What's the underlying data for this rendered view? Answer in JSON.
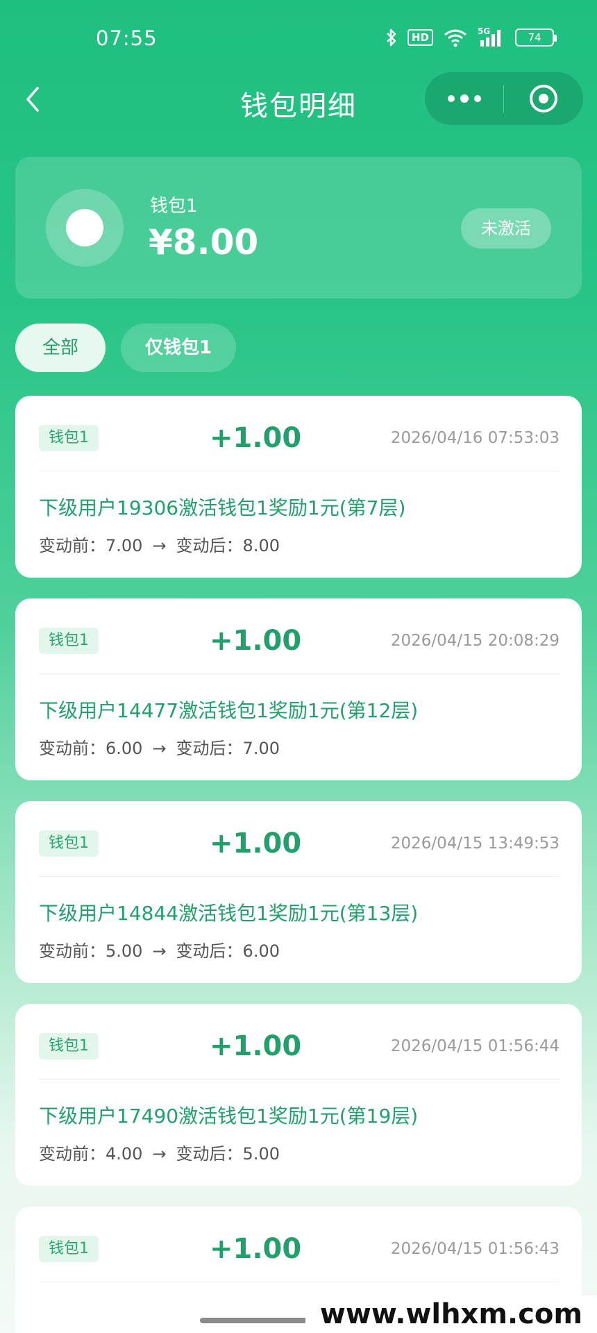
{
  "status_bar": {
    "time": "07:55",
    "network": "5G",
    "battery": "74",
    "hd": "HD"
  },
  "nav": {
    "title": "钱包明细"
  },
  "wallet": {
    "name": "钱包1",
    "balance": "¥8.00",
    "status": "未激活"
  },
  "tabs": [
    {
      "label": "全部",
      "selected": true
    },
    {
      "label": "仅钱包1",
      "selected": false
    }
  ],
  "transactions": [
    {
      "wallet": "钱包1",
      "amount": "+1.00",
      "time": "2026/04/16 07:53:03",
      "desc": "下级用户19306激活钱包1奖励1元(第7层)",
      "before_label": "变动前：",
      "before": "7.00",
      "arrow": "→",
      "after_label": "变动后：",
      "after": "8.00"
    },
    {
      "wallet": "钱包1",
      "amount": "+1.00",
      "time": "2026/04/15 20:08:29",
      "desc": "下级用户14477激活钱包1奖励1元(第12层)",
      "before_label": "变动前：",
      "before": "6.00",
      "arrow": "→",
      "after_label": "变动后：",
      "after": "7.00"
    },
    {
      "wallet": "钱包1",
      "amount": "+1.00",
      "time": "2026/04/15 13:49:53",
      "desc": "下级用户14844激活钱包1奖励1元(第13层)",
      "before_label": "变动前：",
      "before": "5.00",
      "arrow": "→",
      "after_label": "变动后：",
      "after": "6.00"
    },
    {
      "wallet": "钱包1",
      "amount": "+1.00",
      "time": "2026/04/15 01:56:44",
      "desc": "下级用户17490激活钱包1奖励1元(第19层)",
      "before_label": "变动前：",
      "before": "4.00",
      "arrow": "→",
      "after_label": "变动后：",
      "after": "5.00"
    },
    {
      "wallet": "钱包1",
      "amount": "+1.00",
      "time": "2026/04/15 01:56:43",
      "desc": "",
      "before_label": "",
      "before": "",
      "arrow": "",
      "after_label": "",
      "after": ""
    }
  ],
  "watermark": "www.wlhxm.com",
  "colors": {
    "primary": "#22a06b",
    "header_green": "#1fbf7f",
    "badge_bg": "#e3f6ec"
  }
}
